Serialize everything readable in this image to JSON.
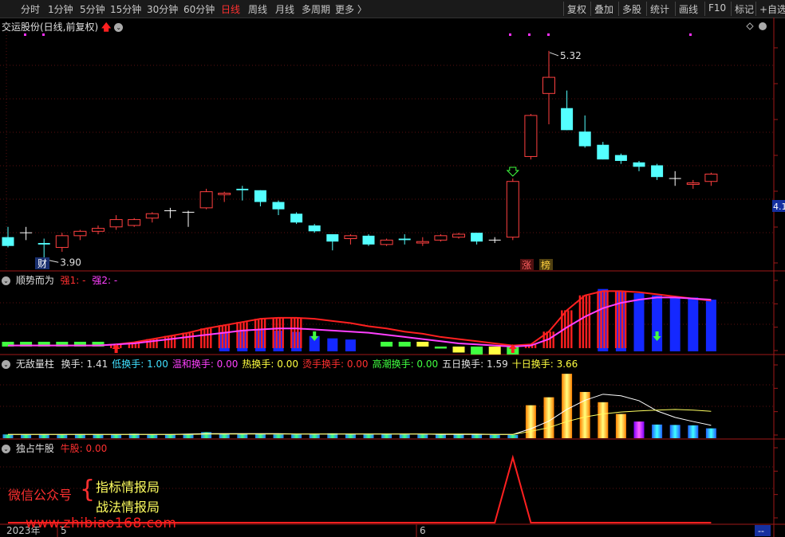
{
  "toolbar": {
    "items": [
      "分时",
      "1分钟",
      "5分钟",
      "15分钟",
      "30分钟",
      "60分钟",
      "日线",
      "周线",
      "月线",
      "多周期",
      "更多 〉"
    ],
    "active_index": 6,
    "right_items": [
      "复权",
      "叠加",
      "多股",
      "统计",
      "画线",
      "F10",
      "标记",
      "+自选"
    ]
  },
  "main_panel": {
    "title": "交运股份(日线,前复权)",
    "high_label": "5.32",
    "low_label": "3.90",
    "price_tag": "4.1",
    "badge_cai": "财",
    "badge_zhang": "涨",
    "badge_bang": "榜"
  },
  "panel2": {
    "name": "顺势而为",
    "label_a": "强1: -",
    "label_b": "强2: -"
  },
  "panel3": {
    "name": "无敌量柱",
    "fields": [
      {
        "text": "换手: 1.41",
        "color": "#e0e0e0"
      },
      {
        "text": "低换手: 1.00",
        "color": "#40e0ff"
      },
      {
        "text": "温和换手: 0.00",
        "color": "#ff40ff"
      },
      {
        "text": "热换手: 0.00",
        "color": "#ffff40"
      },
      {
        "text": "烫手换手: 0.00",
        "color": "#ff3030"
      },
      {
        "text": "高潮换手: 0.00",
        "color": "#40ff40"
      },
      {
        "text": "五日换手: 1.59",
        "color": "#e0e0e0"
      },
      {
        "text": "十日换手: 3.66",
        "color": "#ffff40"
      }
    ]
  },
  "panel4": {
    "name": "独占牛股",
    "label": "牛股: 0.00"
  },
  "watermark": {
    "left": "微信公众号",
    "line1": "指标情报局",
    "line2": "战法情报局",
    "url": "www.zhibiao168.com"
  },
  "xaxis": {
    "year": "2023年",
    "m5": "5",
    "m6": "6",
    "corner": "--"
  },
  "chart_data": [
    {
      "type": "candlestick",
      "title": "交运股份(日线,前复权)",
      "candles": [
        {
          "o": 4.05,
          "h": 4.12,
          "l": 3.98,
          "c": 3.99
        },
        {
          "o": 4.08,
          "h": 4.12,
          "l": 4.03,
          "c": 4.08
        },
        {
          "o": 4.01,
          "h": 4.04,
          "l": 3.9,
          "c": 4.0
        },
        {
          "o": 3.98,
          "h": 4.08,
          "l": 3.95,
          "c": 4.06
        },
        {
          "o": 4.06,
          "h": 4.1,
          "l": 4.03,
          "c": 4.09
        },
        {
          "o": 4.09,
          "h": 4.13,
          "l": 4.07,
          "c": 4.11
        },
        {
          "o": 4.12,
          "h": 4.2,
          "l": 4.1,
          "c": 4.17
        },
        {
          "o": 4.13,
          "h": 4.18,
          "l": 4.12,
          "c": 4.17
        },
        {
          "o": 4.18,
          "h": 4.22,
          "l": 4.15,
          "c": 4.21
        },
        {
          "o": 4.23,
          "h": 4.25,
          "l": 4.18,
          "c": 4.23
        },
        {
          "o": 4.22,
          "h": 4.23,
          "l": 4.12,
          "c": 4.22
        },
        {
          "o": 4.25,
          "h": 4.38,
          "l": 4.24,
          "c": 4.36
        },
        {
          "o": 4.34,
          "h": 4.36,
          "l": 4.29,
          "c": 4.35
        },
        {
          "o": 4.38,
          "h": 4.4,
          "l": 4.3,
          "c": 4.37
        },
        {
          "o": 4.37,
          "h": 4.37,
          "l": 4.26,
          "c": 4.29
        },
        {
          "o": 4.29,
          "h": 4.3,
          "l": 4.2,
          "c": 4.24
        },
        {
          "o": 4.21,
          "h": 4.22,
          "l": 4.14,
          "c": 4.15
        },
        {
          "o": 4.13,
          "h": 4.14,
          "l": 4.08,
          "c": 4.09
        },
        {
          "o": 4.07,
          "h": 4.07,
          "l": 3.96,
          "c": 4.02
        },
        {
          "o": 4.04,
          "h": 4.07,
          "l": 4.0,
          "c": 4.06
        },
        {
          "o": 4.06,
          "h": 4.07,
          "l": 3.99,
          "c": 4.0
        },
        {
          "o": 4.0,
          "h": 4.04,
          "l": 3.99,
          "c": 4.03
        },
        {
          "o": 4.04,
          "h": 4.07,
          "l": 4.0,
          "c": 4.03
        },
        {
          "o": 4.01,
          "h": 4.05,
          "l": 3.99,
          "c": 4.02
        },
        {
          "o": 4.03,
          "h": 4.07,
          "l": 4.02,
          "c": 4.06
        },
        {
          "o": 4.05,
          "h": 4.08,
          "l": 4.04,
          "c": 4.07
        },
        {
          "o": 4.08,
          "h": 4.08,
          "l": 4.0,
          "c": 4.02
        },
        {
          "o": 4.03,
          "h": 4.05,
          "l": 4.01,
          "c": 4.03
        },
        {
          "o": 4.05,
          "h": 4.45,
          "l": 4.03,
          "c": 4.43
        },
        {
          "o": 4.6,
          "h": 4.89,
          "l": 4.58,
          "c": 4.88
        },
        {
          "o": 5.03,
          "h": 5.32,
          "l": 4.82,
          "c": 5.14
        },
        {
          "o": 4.93,
          "h": 5.05,
          "l": 4.78,
          "c": 4.78
        },
        {
          "o": 4.77,
          "h": 4.88,
          "l": 4.66,
          "c": 4.67
        },
        {
          "o": 4.68,
          "h": 4.7,
          "l": 4.58,
          "c": 4.58
        },
        {
          "o": 4.61,
          "h": 4.62,
          "l": 4.55,
          "c": 4.57
        },
        {
          "o": 4.56,
          "h": 4.57,
          "l": 4.5,
          "c": 4.53
        },
        {
          "o": 4.54,
          "h": 4.55,
          "l": 4.44,
          "c": 4.46
        },
        {
          "o": 4.45,
          "h": 4.5,
          "l": 4.4,
          "c": 4.45
        },
        {
          "o": 4.41,
          "h": 4.44,
          "l": 4.38,
          "c": 4.42
        },
        {
          "o": 4.43,
          "h": 4.49,
          "l": 4.4,
          "c": 4.48
        }
      ],
      "ylim": [
        3.82,
        5.45
      ],
      "high": 5.32,
      "low": 3.9
    },
    {
      "type": "bar",
      "title": "顺势而为",
      "values": [
        6,
        5,
        4,
        4,
        4,
        4,
        5,
        8,
        11,
        14,
        17,
        21,
        25,
        27,
        28,
        27,
        25,
        18,
        14,
        12,
        8,
        6,
        4,
        2,
        -1,
        -3,
        -4,
        -4,
        -4,
        0,
        26,
        43,
        52,
        54,
        52,
        50,
        48,
        46,
        46,
        44
      ],
      "line_red": [
        1,
        1,
        1,
        1,
        1,
        1,
        2,
        4,
        7,
        10,
        13,
        17,
        20,
        23,
        26,
        27,
        27,
        26,
        24,
        22,
        19,
        17,
        14,
        12,
        9,
        7,
        5,
        3,
        1,
        2,
        14,
        34,
        48,
        52,
        52,
        51,
        49,
        47,
        45,
        43
      ],
      "line_purple": [
        1,
        1,
        1,
        1,
        1,
        1,
        2,
        3,
        5,
        7,
        9,
        11,
        13,
        15,
        16,
        17,
        17,
        16,
        15,
        14,
        13,
        11,
        9,
        7,
        5,
        3,
        2,
        1,
        0,
        1,
        7,
        18,
        28,
        36,
        41,
        44,
        46,
        46,
        45,
        44
      ],
      "ylim": [
        -6,
        62
      ]
    },
    {
      "type": "bar",
      "title": "无敌量柱",
      "values": [
        1.0,
        1.0,
        1.1,
        1.0,
        1.1,
        1.0,
        1.0,
        1.2,
        1.0,
        1.0,
        1.1,
        1.6,
        1.1,
        1.2,
        1.1,
        1.0,
        1.0,
        1.0,
        1.3,
        1.1,
        1.0,
        1.1,
        1.0,
        1.0,
        1.0,
        1.0,
        1.0,
        0.9,
        0.9,
        8.7,
        10.8,
        17.0,
        12.2,
        9.5,
        6.4,
        4.4,
        3.6,
        3.5,
        3.4,
        2.6
      ],
      "ma5": [
        1.0,
        1.0,
        1.0,
        1.0,
        1.0,
        1.0,
        1.0,
        1.0,
        1.0,
        1.0,
        1.1,
        1.2,
        1.2,
        1.2,
        1.2,
        1.2,
        1.1,
        1.1,
        1.1,
        1.1,
        1.1,
        1.1,
        1.1,
        1.1,
        1.0,
        1.0,
        1.0,
        1.0,
        1.0,
        2.5,
        4.5,
        7.6,
        10.0,
        11.6,
        11.2,
        9.9,
        7.2,
        5.5,
        4.4,
        3.4
      ],
      "ma10": [
        1.0,
        1.0,
        1.0,
        1.0,
        1.0,
        1.0,
        1.0,
        1.0,
        1.0,
        1.0,
        1.0,
        1.1,
        1.1,
        1.1,
        1.1,
        1.1,
        1.1,
        1.1,
        1.1,
        1.1,
        1.1,
        1.1,
        1.1,
        1.1,
        1.1,
        1.1,
        1.1,
        1.0,
        1.0,
        1.8,
        2.8,
        4.4,
        5.6,
        6.4,
        6.9,
        7.2,
        7.4,
        7.6,
        7.4,
        7.1
      ],
      "ylim": [
        0,
        18.5
      ]
    },
    {
      "type": "line",
      "title": "独占牛股",
      "values": [
        0,
        0,
        0,
        0,
        0,
        0,
        0,
        0,
        0,
        0,
        0,
        0,
        0,
        0,
        0,
        0,
        0,
        0,
        0,
        0,
        0,
        0,
        0,
        0,
        0,
        0,
        0,
        0,
        1,
        0,
        0,
        0,
        0,
        0,
        0,
        0,
        0,
        0,
        0,
        0
      ],
      "ylim": [
        0,
        1.15
      ]
    }
  ]
}
